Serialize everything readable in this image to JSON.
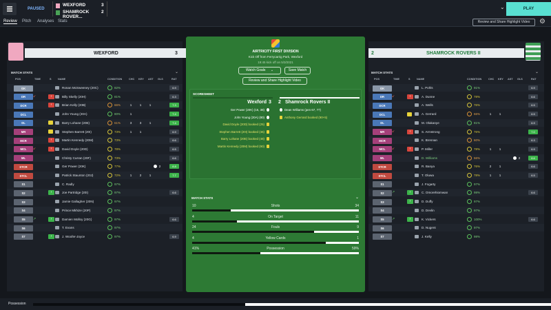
{
  "topbar": {
    "status": "PAUSED",
    "home_team": "WEXFORD",
    "home_score": "3",
    "away_team": "SHAMROCK ROVER...",
    "away_score": "2",
    "play_label": "PLAY"
  },
  "nav": {
    "tabs": [
      "Review",
      "Pitch",
      "Analyses",
      "Stats"
    ],
    "share_button": "Review and Share Highlight Video"
  },
  "home": {
    "name": "WEXFORD",
    "score": "3",
    "section_title": "MATCH STATS",
    "headers": {
      "pos": "POS",
      "time": "TIME",
      "s": "S",
      "name": "NAME",
      "cond": "CONDITION",
      "chc": "CHC",
      "key": "KEY",
      "ast": "AST",
      "gls": "GLS",
      "rat": "RAT"
    },
    "players": [
      {
        "pos": "GK",
        "name": "Ronan McSweeney (20C)",
        "cond": "82%",
        "chc": "",
        "key": "",
        "ast": "",
        "gls": "",
        "rat": "6.9"
      },
      {
        "pos": "DR",
        "name": "Billy Skelly (20H)",
        "cond": "81%",
        "chc": "",
        "key": "",
        "ast": "",
        "gls": "",
        "rat": "6.3"
      },
      {
        "pos": "DCR",
        "name": "Brian Kelly (20B)",
        "cond": "66%",
        "chc": "1",
        "key": "1",
        "ast": "1",
        "gls": "",
        "rat": "7.3"
      },
      {
        "pos": "DCL",
        "name": "John Young (20A)",
        "cond": "80%",
        "chc": "1",
        "key": "",
        "ast": "",
        "gls": "",
        "rat": "7.4"
      },
      {
        "pos": "DL",
        "name": "Barry Lohane (20E)",
        "cond": "61%",
        "chc": "3",
        "key": "3",
        "ast": "1",
        "gls": "",
        "rat": "7.4"
      },
      {
        "pos": "MR",
        "name": "Stephen Barrett (20I)",
        "cond": "73%",
        "chc": "1",
        "key": "1",
        "ast": "",
        "gls": "",
        "rat": "6.9"
      },
      {
        "pos": "MCR",
        "name": "Martin Kennedy (20M)",
        "cond": "73%",
        "chc": "",
        "key": "",
        "ast": "",
        "gls": "",
        "rat": "6.6"
      },
      {
        "pos": "MCL",
        "name": "David Doyle (20D)",
        "cond": "78%",
        "chc": "",
        "key": "",
        "ast": "",
        "gls": "",
        "rat": "6.5"
      },
      {
        "pos": "ML",
        "name": "Christy Curran (20F)",
        "cond": "73%",
        "chc": "",
        "key": "",
        "ast": "",
        "gls": "",
        "rat": "6.6"
      },
      {
        "pos": "STCR",
        "name": "Ger Power (20K)",
        "cond": "77%",
        "chc": "",
        "key": "",
        "ast": "",
        "gls": "2",
        "rat": "8.8"
      },
      {
        "pos": "STCL",
        "name": "Patrick Staunton (20J)",
        "cond": "72%",
        "chc": "1",
        "key": "2",
        "ast": "1",
        "gls": "",
        "rat": "7.7"
      },
      {
        "pos": "S1",
        "name": "C. Radly",
        "cond": "97%",
        "chc": "",
        "key": "",
        "ast": "",
        "gls": "",
        "rat": ""
      },
      {
        "pos": "S2",
        "name": "Joe Partridge (20I)",
        "cond": "97%",
        "chc": "",
        "key": "",
        "ast": "",
        "gls": "",
        "rat": "6.6"
      },
      {
        "pos": "S3",
        "name": "Jamie Gallagher (20N)",
        "cond": "97%",
        "chc": "",
        "key": "",
        "ast": "",
        "gls": "",
        "rat": ""
      },
      {
        "pos": "S4",
        "name": "Prince Mkhize (20P)",
        "cond": "97%",
        "chc": "",
        "key": "",
        "ast": "",
        "gls": "",
        "rat": ""
      },
      {
        "pos": "S5",
        "name": "Damien Molloy (20G)",
        "cond": "97%",
        "chc": "",
        "key": "",
        "ast": "",
        "gls": "",
        "rat": "6.6"
      },
      {
        "pos": "S6",
        "name": "T. Evans",
        "cond": "97%",
        "chc": "",
        "key": "",
        "ast": "",
        "gls": "",
        "rat": ""
      },
      {
        "pos": "S7",
        "name": "J. Woofer-Joyce",
        "cond": "97%",
        "chc": "",
        "key": "",
        "ast": "",
        "gls": "",
        "rat": "6.9"
      }
    ]
  },
  "away": {
    "name": "SHAMROCK ROVERS II",
    "score": "2",
    "section_title": "MATCH STATS",
    "players": [
      {
        "pos": "GK",
        "name": "L. Pohls",
        "cond": "91%",
        "chc": "",
        "key": "",
        "ast": "",
        "gls": "",
        "rat": "6.9"
      },
      {
        "pos": "DR",
        "name": "A. Dunne",
        "cond": "78%",
        "chc": "",
        "key": "",
        "ast": "",
        "gls": "",
        "rat": "6.6"
      },
      {
        "pos": "DCR",
        "name": "A. Wells",
        "cond": "76%",
        "chc": "",
        "key": "",
        "ast": "",
        "gls": "",
        "rat": "6.5"
      },
      {
        "pos": "DCL",
        "name": "A. Gerrard",
        "cond": "66%",
        "chc": "1",
        "key": "1",
        "ast": "",
        "gls": "",
        "rat": "6.5"
      },
      {
        "pos": "DL",
        "name": "M. Olakanye",
        "cond": "81%",
        "chc": "",
        "key": "",
        "ast": "",
        "gls": "",
        "rat": "6.9"
      },
      {
        "pos": "MR",
        "name": "S. Armstrong",
        "cond": "76%",
        "chc": "",
        "key": "",
        "ast": "",
        "gls": "",
        "rat": "7.0"
      },
      {
        "pos": "MCR",
        "name": "K. Brennan",
        "cond": "60%",
        "chc": "",
        "key": "",
        "ast": "",
        "gls": "",
        "rat": "6.3"
      },
      {
        "pos": "MCL",
        "name": "P. Miller",
        "cond": "78%",
        "chc": "1",
        "key": "1",
        "ast": "",
        "gls": "",
        "rat": "6.9"
      },
      {
        "pos": "ML",
        "name": "D. Williams",
        "cond": "56%",
        "chc": "",
        "key": "",
        "ast": "",
        "gls": "2",
        "rat": "8.6"
      },
      {
        "pos": "STCR",
        "name": "R. Banya",
        "cond": "76%",
        "chc": "2",
        "key": "1",
        "ast": "",
        "gls": "",
        "rat": "6.6"
      },
      {
        "pos": "STCL",
        "name": "T. Oluwa",
        "cond": "78%",
        "chc": "1",
        "key": "1",
        "ast": "",
        "gls": "",
        "rat": "6.5"
      },
      {
        "pos": "S1",
        "name": "J. Fogarty",
        "cond": "97%",
        "chc": "",
        "key": "",
        "ast": "",
        "gls": "",
        "rat": ""
      },
      {
        "pos": "S2",
        "name": "C. Omorehiomwan",
        "cond": "98%",
        "chc": "",
        "key": "",
        "ast": "",
        "gls": "",
        "rat": "6.6"
      },
      {
        "pos": "S3",
        "name": "D. Duffy",
        "cond": "97%",
        "chc": "",
        "key": "",
        "ast": "",
        "gls": "",
        "rat": ""
      },
      {
        "pos": "S4",
        "name": "D. Devlin",
        "cond": "97%",
        "chc": "",
        "key": "",
        "ast": "",
        "gls": "",
        "rat": ""
      },
      {
        "pos": "S5",
        "name": "K. Vickers",
        "cond": "100%",
        "chc": "",
        "key": "",
        "ast": "",
        "gls": "",
        "rat": "6.6"
      },
      {
        "pos": "S6",
        "name": "D. Nugent",
        "cond": "97%",
        "chc": "",
        "key": "",
        "ast": "",
        "gls": "",
        "rat": ""
      },
      {
        "pos": "S7",
        "name": "J. Kelly",
        "cond": "98%",
        "chc": "",
        "key": "",
        "ast": "",
        "gls": "",
        "rat": ""
      }
    ]
  },
  "center": {
    "competition": "AIRTRICITY FIRST DIVISION",
    "kickoff": "Kick Off from Ferrycarrig Park, Wexford",
    "time": "19:45 kick off on 5/3/2021",
    "watch_goals": "Watch Goals",
    "save_match": "Save Match",
    "share_video": "Review and Share Highlight Video",
    "scoresheet_title": "SCORESHEET",
    "home_team": "Wexford",
    "home_score": "3",
    "away_score": "2",
    "away_team": "Shamrock Rovers II",
    "home_events": [
      "Ger Power (20K) (15, 38)",
      "John Young (20A) (80)",
      "David Doyle (20D) booked (25)",
      "Stephen Barrett (20I) booked (46)",
      "Barry Lohane (20E) booked (48)",
      "Martin Kennedy (20M) booked (90)"
    ],
    "away_events": [
      "Dean Williams (pen 67, 77)",
      "Anthony Gerrard booked (90+5)"
    ],
    "stats_title": "MATCH STATS",
    "stats": [
      {
        "label": "Shots",
        "home": "10",
        "away": "34",
        "home_frac": 0.23
      },
      {
        "label": "On Target",
        "home": "4",
        "away": "11",
        "home_frac": 0.27
      },
      {
        "label": "Fouls",
        "home": "24",
        "away": "9",
        "home_frac": 0.73
      },
      {
        "label": "Yellow Cards",
        "home": "4",
        "away": "1",
        "home_frac": 0.8
      },
      {
        "label": "Possession",
        "home": "41%",
        "away": "59%",
        "home_frac": 0.41
      }
    ]
  },
  "bottom": {
    "label": "Possession",
    "home_frac": 0.41
  }
}
